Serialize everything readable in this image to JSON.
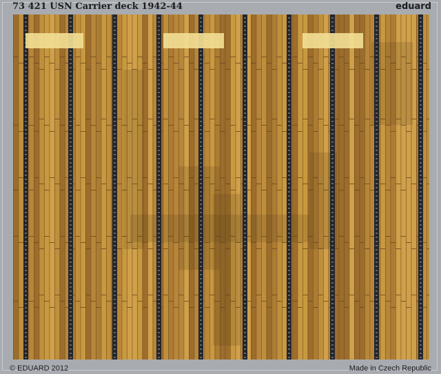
{
  "header": {
    "title": "73 421  USN Carrier deck 1942-44",
    "brand": "eduard"
  },
  "footer": {
    "copyright": "© EDUARD 2012",
    "origin": "Made in Czech Republic"
  },
  "colors": {
    "fret_background": "#a8acb1",
    "wood_light": "#c9993f",
    "wood_mid": "#b8863a",
    "wood_dark": "#9c6d2b",
    "plank_line": "#6b4a1c",
    "tie_down_strip": "#23252b",
    "light_panel": "#f1dd92"
  }
}
